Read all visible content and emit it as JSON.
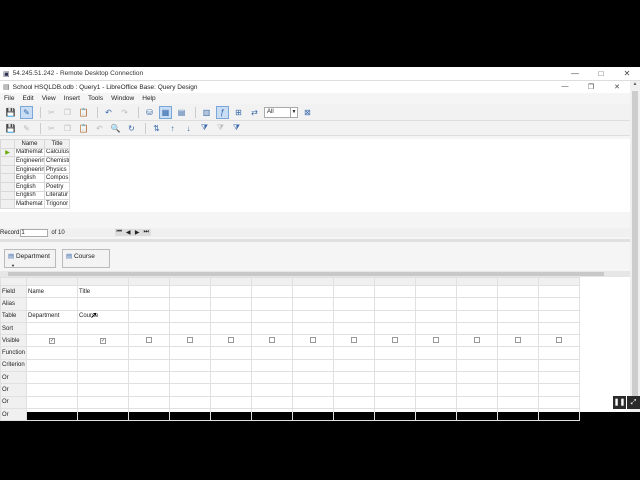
{
  "rdp": {
    "title": "54.245.51.242 - Remote Desktop Connection",
    "min": "—",
    "max": "□",
    "close": "✕"
  },
  "app": {
    "title": "School HSQLDB.odb : Query1 - LibreOffice Base: Query Design",
    "min": "—",
    "restore": "❐",
    "close": "✕"
  },
  "menu": [
    "File",
    "Edit",
    "View",
    "Insert",
    "Tools",
    "Window",
    "Help"
  ],
  "toolbar": {
    "limit_value": "All"
  },
  "result": {
    "headers": [
      "Name",
      "Title"
    ],
    "rows": [
      [
        "Mathemat",
        "Calculus"
      ],
      [
        "Engineerin",
        "Chemistr"
      ],
      [
        "Engineerin",
        "Physics"
      ],
      [
        "English",
        "Compos"
      ],
      [
        "English",
        "Poetry"
      ],
      [
        "English",
        "Literatur"
      ],
      [
        "Mathemat",
        "Trigonor"
      ]
    ],
    "record_label": "Record",
    "record_value": "1",
    "of_label": "of 10"
  },
  "tables": [
    "Department",
    "Course"
  ],
  "design": {
    "row_labels": [
      "Field",
      "Alias",
      "Table",
      "Sort",
      "Visible",
      "Function",
      "Criterion",
      "Or",
      "Or",
      "Or",
      "Or"
    ],
    "columns": [
      {
        "field": "Name",
        "table": "Department",
        "visible": true
      },
      {
        "field": "Title",
        "table": "Course",
        "visible": true
      }
    ]
  }
}
